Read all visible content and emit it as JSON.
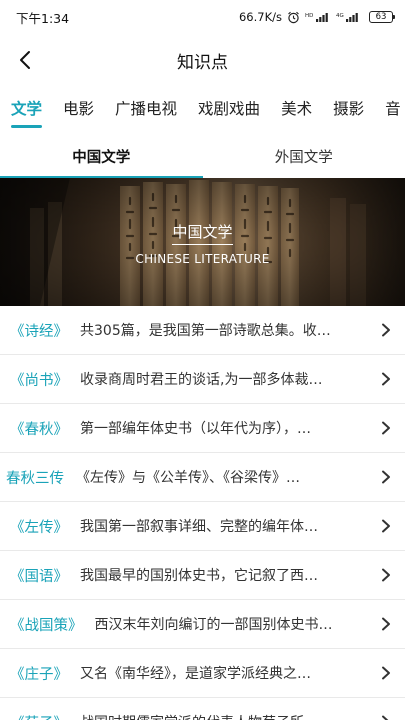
{
  "status_bar": {
    "time": "下午1:34",
    "network_speed": "66.7K/s",
    "battery_level": "63",
    "icons": [
      "alarm-icon",
      "hd-icon",
      "signal-icon",
      "4g-icon",
      "signal-icon",
      "battery-icon"
    ]
  },
  "header": {
    "title": "知识点",
    "back_icon": "chevron-left-icon"
  },
  "category_tabs": [
    {
      "label": "文学",
      "active": true
    },
    {
      "label": "电影",
      "active": false
    },
    {
      "label": "广播电视",
      "active": false
    },
    {
      "label": "戏剧戏曲",
      "active": false
    },
    {
      "label": "美术",
      "active": false
    },
    {
      "label": "摄影",
      "active": false
    },
    {
      "label": "音",
      "active": false
    }
  ],
  "sub_tabs": [
    {
      "label": "中国文学",
      "active": true
    },
    {
      "label": "外国文学",
      "active": false
    }
  ],
  "banner": {
    "title": "中国文学",
    "subtitle": "CHINESE LITERATURE"
  },
  "items": [
    {
      "title": "《诗经》",
      "desc": "共305篇，是我国第一部诗歌总集。收…"
    },
    {
      "title": "《尚书》",
      "desc": "收录商周时君王的谈话,为一部多体裁…"
    },
    {
      "title": "《春秋》",
      "desc": "第一部编年体史书（以年代为序），…"
    },
    {
      "title": "春秋三传",
      "desc": "《左传》与《公羊传》、《谷梁传》…"
    },
    {
      "title": "《左传》",
      "desc": "我国第一部叙事详细、完整的编年体…"
    },
    {
      "title": "《国语》",
      "desc": "我国最早的国别体史书，它记叙了西…"
    },
    {
      "title": "《战国策》",
      "desc": "西汉末年刘向编订的一部国别体史书…"
    },
    {
      "title": "《庄子》",
      "desc": "又名《南华经》，是道家学派经典之…"
    },
    {
      "title": "《荀子》",
      "desc": "战国时期儒家学派的代表人物荀子所…"
    }
  ],
  "colors": {
    "accent": "#1aa3b8",
    "text": "#333333",
    "divider": "#e9e9e9"
  }
}
